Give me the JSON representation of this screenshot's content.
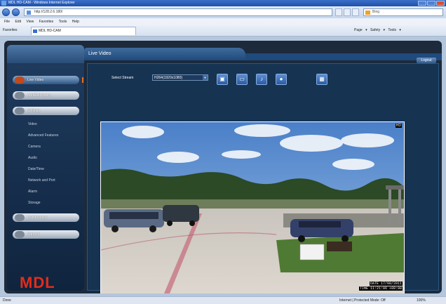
{
  "window": {
    "title": "MDL HD-CAM - Windows Internet Explorer"
  },
  "address": {
    "url": "http://128.2.6.180/"
  },
  "search": {
    "placeholder": "Bing"
  },
  "menu": [
    "File",
    "Edit",
    "View",
    "Favorites",
    "Tools",
    "Help"
  ],
  "favorites": {
    "label": "Favorites",
    "tab": "MDL HD-CAM",
    "commands": "Page ▾  Safety ▾  Tools ▾"
  },
  "page": {
    "title": "Live Video",
    "logout": "Logout"
  },
  "sidebar": {
    "items": [
      {
        "label": "Live Video",
        "active": true
      },
      {
        "label": "Add/Edit Users",
        "active": false
      },
      {
        "label": "Settings",
        "active": false
      },
      {
        "label": "Maintenance",
        "active": false
      },
      {
        "label": "Support",
        "active": false
      }
    ],
    "subitems": [
      "Video",
      "Advanced Features",
      "Camera",
      "Audio",
      "Date/Time",
      "Network and Port",
      "Alarm",
      "Storage"
    ],
    "logo": "MDL"
  },
  "stream": {
    "label": "Select Stream",
    "value": "H264(1920x1080)"
  },
  "toolbar": [
    {
      "icon": "snapshot-icon"
    },
    {
      "icon": "record-icon"
    },
    {
      "icon": "audio-icon"
    },
    {
      "icon": "zoom-icon"
    },
    {
      "icon": "fullscreen-icon"
    }
  ],
  "video": {
    "badge": "HD",
    "date": "DATE 17/08/2011",
    "time": "TIME 11:21:06 +09:00"
  },
  "status": {
    "left": "Done",
    "zone": "Internet | Protected Mode: Off",
    "zoom": "100%"
  }
}
